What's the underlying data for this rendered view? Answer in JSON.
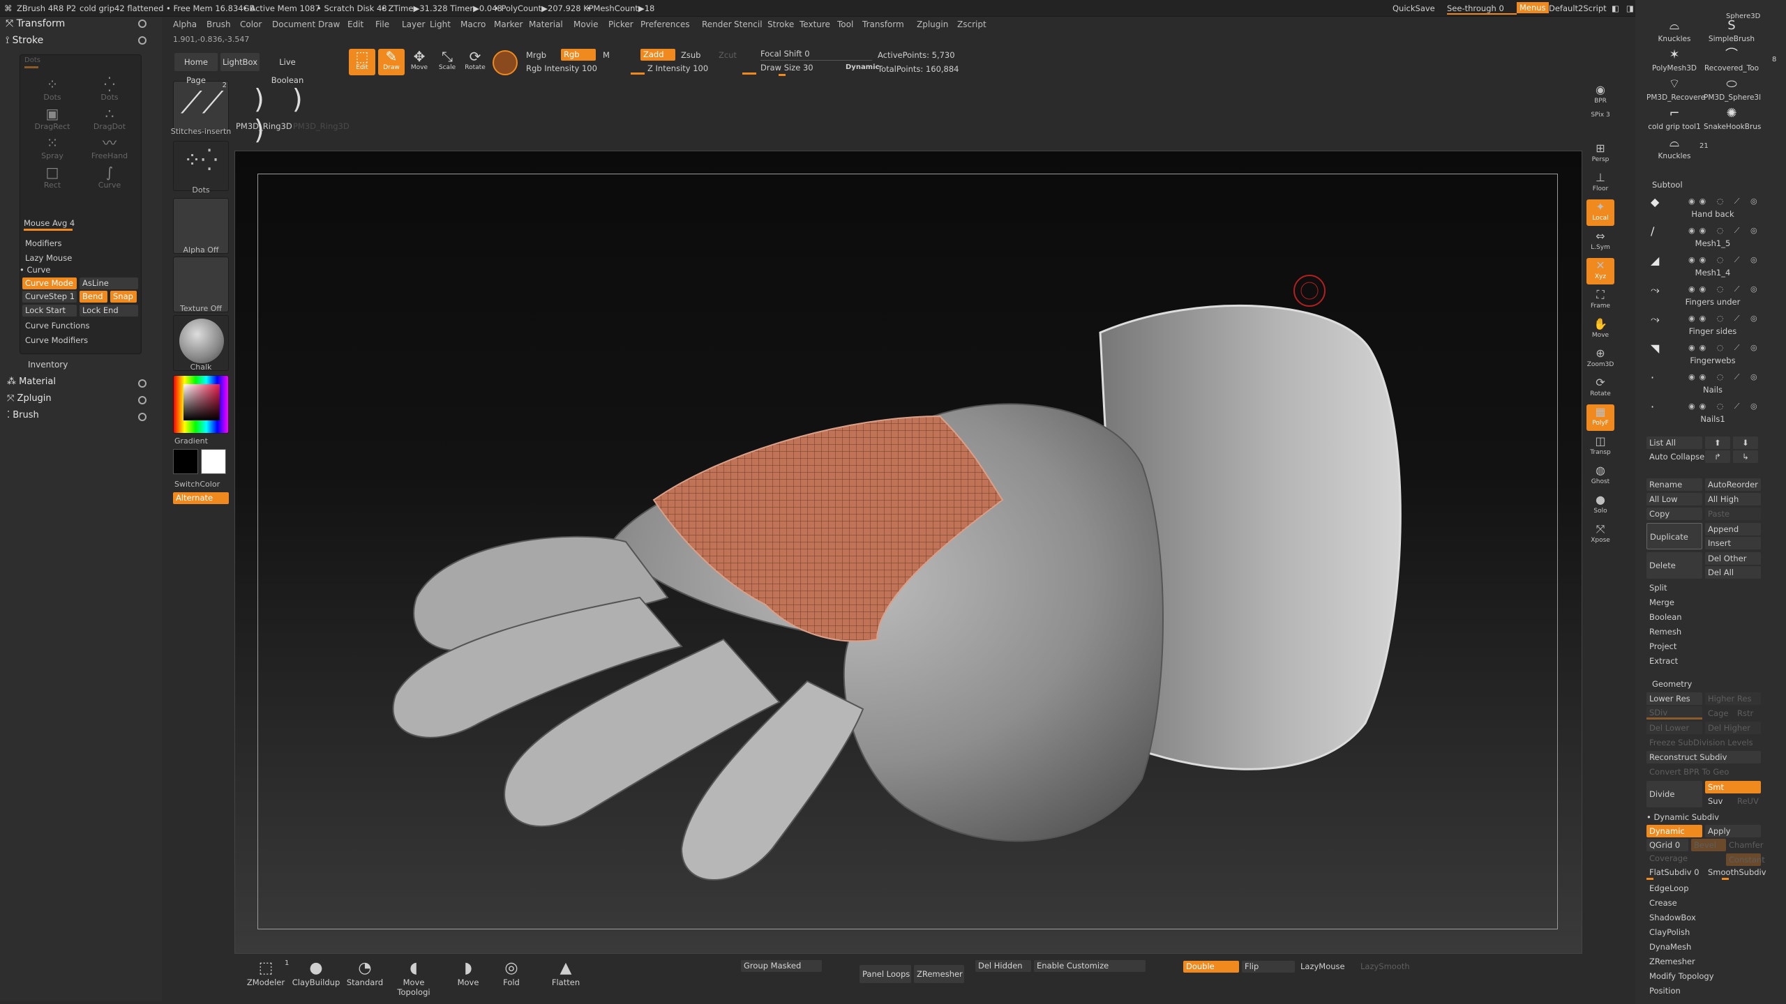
{
  "titlebar": {
    "app": "ZBrush 4R8 P2",
    "file": "cold grip42 flattened",
    "free_mem": "• Free Mem 16.834GB",
    "active_mem": "• Active Mem 1087",
    "scratch_disk": "• Scratch Disk 48",
    "ztime": "• ZTime▶31.328 Timer▶0.048",
    "polycount": "• PolyCount▶207.928 KP",
    "meshcount": "• MeshCount▶18",
    "quicksave": "QuickSave",
    "see_through": "See-through 0",
    "menus": "Menus",
    "default_script": "Default2Script"
  },
  "menubar": [
    "Alpha",
    "Brush",
    "Color",
    "Document",
    "Draw",
    "Edit",
    "File",
    "Layer",
    "Light",
    "Macro",
    "Marker",
    "Material",
    "Movie",
    "Picker",
    "Preferences",
    "Render",
    "Stencil",
    "Stroke",
    "Texture",
    "Tool",
    "Transform",
    "Zplugin",
    "Zscript"
  ],
  "coords": "1.901,-0.836,-3.547",
  "left_panel": {
    "transform": "Transform",
    "stroke": "Stroke",
    "strokes_title": "Dots",
    "stroke_types": [
      {
        "label": "Dots",
        "glyph": "⁘"
      },
      {
        "label": "Dots",
        "glyph": "⁛"
      },
      {
        "label": "DragRect",
        "glyph": "▣"
      },
      {
        "label": "DragDot",
        "glyph": "∴"
      },
      {
        "label": "Spray",
        "glyph": "⁙"
      },
      {
        "label": "FreeHand",
        "glyph": "〰"
      },
      {
        "label": "Rect",
        "glyph": "□"
      },
      {
        "label": "Curve",
        "glyph": "∫"
      }
    ],
    "mouse_avg": "Mouse Avg 4",
    "modifiers": "Modifiers",
    "lazy_mouse": "Lazy Mouse",
    "curve": "Curve",
    "curve_mode": "Curve Mode",
    "asline": "AsLine",
    "curvestep": "CurveStep 1",
    "bend": "Bend",
    "snap": "Snap",
    "lock_start": "Lock Start",
    "lock_end": "Lock End",
    "curve_functions": "Curve Functions",
    "curve_modifiers": "Curve Modifiers",
    "inventory": "Inventory",
    "material": "Material",
    "zplugin": "Zplugin",
    "brush": "Brush"
  },
  "tool_column": {
    "brush_name": "Stitches-insertn",
    "brush_count": "2",
    "stroke_name": "Dots",
    "alpha": "Alpha Off",
    "texture": "Texture Off",
    "material": "Chalk",
    "gradient": "Gradient",
    "switch_color": "SwitchColor",
    "alternate": "Alternate"
  },
  "toolbar": {
    "home_page": "Home Page",
    "lightbox": "LightBox",
    "live_boolean": "Live Boolean",
    "edit": "Edit",
    "draw": "Draw",
    "move": "Move",
    "scale": "Scale",
    "rotate": "Rotate",
    "mrgb": "Mrgb",
    "rgb": "Rgb",
    "m": "M",
    "rgb_intensity": "Rgb Intensity 100",
    "zadd": "Zadd",
    "zsub": "Zsub",
    "zcut": "Zcut",
    "z_intensity": "Z Intensity 100",
    "focal_shift": "Focal Shift 0",
    "draw_size": "Draw Size 30",
    "dynamic": "Dynamic",
    "active_points": "ActivePoints: 5,730",
    "total_points": "TotalPoints: 160,884",
    "current_tool": "PM3D_Ring3D",
    "current_tool_ghost": "PM3D_Ring3D"
  },
  "shelf": [
    {
      "label": "BPR",
      "glyph": "◉",
      "on": false
    },
    {
      "label": "SPix 3",
      "glyph": "",
      "on": false
    },
    {
      "label": "Persp",
      "glyph": "⊞",
      "on": false
    },
    {
      "label": "Floor",
      "glyph": "⊥",
      "on": false
    },
    {
      "label": "Local",
      "glyph": "✦",
      "on": true
    },
    {
      "label": "L.Sym",
      "glyph": "⇔",
      "on": false
    },
    {
      "label": "Xyz",
      "glyph": "✕",
      "on": true
    },
    {
      "label": "Frame",
      "glyph": "⛶",
      "on": false
    },
    {
      "label": "Move",
      "glyph": "✋",
      "on": false
    },
    {
      "label": "Zoom3D",
      "glyph": "⊕",
      "on": false
    },
    {
      "label": "Rotate",
      "glyph": "⟳",
      "on": false
    },
    {
      "label": "PolyF",
      "glyph": "▦",
      "on": true
    },
    {
      "label": "Transp",
      "glyph": "◫",
      "on": false
    },
    {
      "label": "Ghost",
      "glyph": "◍",
      "on": false
    },
    {
      "label": "Solo",
      "glyph": "●",
      "on": false
    },
    {
      "label": "Xpose",
      "glyph": "⤧",
      "on": false
    }
  ],
  "right_panel": {
    "tools": [
      {
        "label": "Knuckles",
        "glyph": "⌓"
      },
      {
        "label": "SimpleBrush",
        "glyph": "S"
      },
      {
        "label": "PolyMesh3D",
        "glyph": "✶"
      },
      {
        "label": "Recovered_Too",
        "glyph": "⌒"
      },
      {
        "label": "PM3D_Recovere",
        "glyph": "⌔"
      },
      {
        "label": "PM3D_Sphere3l",
        "glyph": "⬭"
      },
      {
        "label": "cold grip tool1",
        "glyph": "⌐"
      },
      {
        "label": "SnakeHookBrus",
        "glyph": "✺"
      },
      {
        "label": "Knuckles",
        "glyph": "⌓"
      }
    ],
    "sphere_label": "Sphere3D",
    "count_8": "8",
    "count_21": "21",
    "subtool": "Subtool",
    "subtools": [
      {
        "name": "Hand back",
        "glyph": "◆"
      },
      {
        "name": "Mesh1_5",
        "glyph": "∕"
      },
      {
        "name": "Mesh1_4",
        "glyph": "◢"
      },
      {
        "name": "Fingers under",
        "glyph": "⤳"
      },
      {
        "name": "Finger sides",
        "glyph": "⤳"
      },
      {
        "name": "Fingerwebs",
        "glyph": "◥"
      },
      {
        "name": "Nails",
        "glyph": "·"
      },
      {
        "name": "Nails1",
        "glyph": "·"
      }
    ],
    "subtool_toggles": "◉◉ ◌ ⟋ ◎",
    "list_all": "List All",
    "auto_collapse": "Auto Collapse",
    "rename": "Rename",
    "auto_reorder": "AutoReorder",
    "all_low": "All Low",
    "all_high": "All High",
    "copy": "Copy",
    "paste": "Paste",
    "duplicate": "Duplicate",
    "append": "Append",
    "insert": "Insert",
    "delete": "Delete",
    "del_other": "Del Other",
    "del_all": "Del All",
    "split": "Split",
    "merge": "Merge",
    "boolean": "Boolean",
    "remesh": "Remesh",
    "project": "Project",
    "extract": "Extract",
    "geometry": "Geometry",
    "lower_res": "Lower Res",
    "higher_res": "Higher Res",
    "sdiv": "SDiv",
    "cage": "Cage",
    "rstr": "Rstr",
    "del_lower": "Del Lower",
    "del_higher": "Del Higher",
    "freeze_subdiv": "Freeze SubDivision Levels",
    "reconstruct_subdiv": "Reconstruct Subdiv",
    "convert_bpr": "Convert BPR To Geo",
    "divide": "Divide",
    "smt": "Smt",
    "suv": "Suv",
    "reuv": "ReUV",
    "dynamic_subdiv": "Dynamic Subdiv",
    "dynamic": "Dynamic",
    "apply": "Apply",
    "qgrid": "QGrid 0",
    "bevel": "Bevel",
    "chamfer": "Chamfer",
    "coverage": "Coverage",
    "constant": "Constant",
    "flatsubdiv": "FlatSubdiv 0",
    "smoothsubdiv": "SmoothSubdiv",
    "edgeloop": "EdgeLoop",
    "crease": "Crease",
    "shadowbox": "ShadowBox",
    "claypolish": "ClayPolish",
    "dynamesh": "DynaMesh",
    "zremesher": "ZRemesher",
    "modify_topology": "Modify Topology",
    "position": "Position"
  },
  "bottom_bar": {
    "brushes": [
      {
        "label": "ZModeler",
        "glyph": "⬚"
      },
      {
        "label": "ClayBuildup",
        "glyph": "●"
      },
      {
        "label": "Standard",
        "glyph": "◔"
      },
      {
        "label": "Move Topologi",
        "glyph": "◖"
      },
      {
        "label": "Move",
        "glyph": "◗"
      },
      {
        "label": "Fold",
        "glyph": "◎"
      },
      {
        "label": "Flatten",
        "glyph": "▲"
      }
    ],
    "zmodeler_count": "1",
    "group_masked": "Group Masked",
    "panel_loops": "Panel Loops",
    "zremesher": "ZRemesher",
    "del_hidden": "Del Hidden",
    "enable_customize": "Enable Customize",
    "double": "Double",
    "flip": "Flip",
    "lazymouse": "LazyMouse",
    "lazysmooth": "LazySmooth"
  },
  "colors": {
    "accent": "#f08a1e",
    "panel": "#2e2e2e",
    "bg": "#2b2b2b"
  }
}
